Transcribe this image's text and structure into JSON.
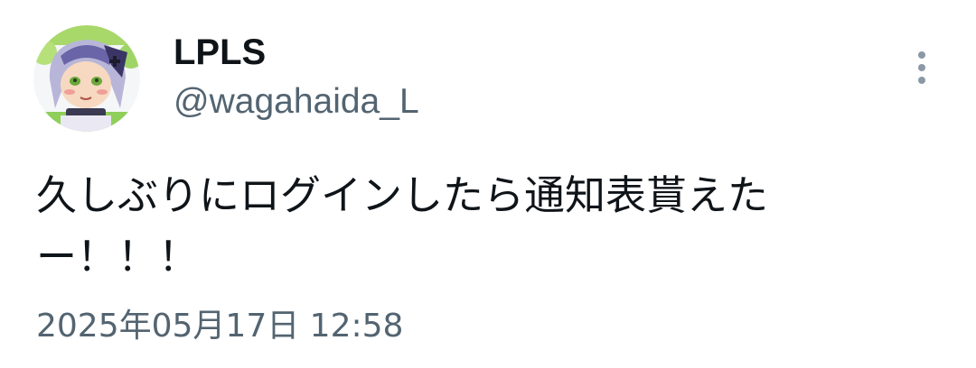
{
  "user": {
    "display_name": "LPLS",
    "handle": "@wagahaida_L",
    "avatar_icon": "avatar-illustration"
  },
  "menu": {
    "icon": "more-vertical-icon"
  },
  "tweet": {
    "text_lines": [
      "久しぶりにログインしたら通知表貰えた",
      "ー！！！"
    ],
    "timestamp": "2025年05月17日 12:58"
  },
  "colors": {
    "primary_text": "#0f1419",
    "secondary_text": "#536471",
    "icon": "#8b98a5",
    "background": "#ffffff"
  }
}
